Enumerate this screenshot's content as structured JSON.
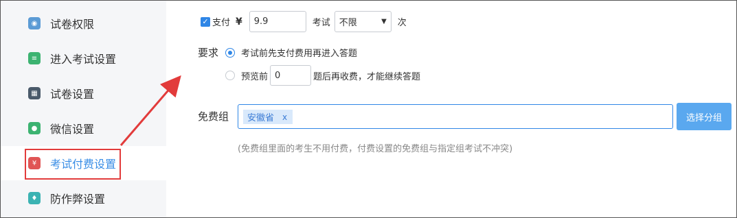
{
  "sidebar": {
    "items": [
      {
        "label": "试卷权限",
        "icon": "permission-icon",
        "color": "#5b9bd5"
      },
      {
        "label": "进入考试设置",
        "icon": "enter-exam-icon",
        "color": "#3cb371"
      },
      {
        "label": "试卷设置",
        "icon": "paper-settings-icon",
        "color": "#4a5a6a"
      },
      {
        "label": "微信设置",
        "icon": "wechat-icon",
        "color": "#3cb371"
      },
      {
        "label": "考试付费设置",
        "icon": "payment-icon",
        "color": "#e05555"
      },
      {
        "label": "防作弊设置",
        "icon": "shield-icon",
        "color": "#3bb3b3"
      }
    ]
  },
  "payment": {
    "pay_label": "支付",
    "currency": "¥",
    "amount": "9.9",
    "exam_label": "考试",
    "times_value": "不限",
    "times_unit": "次"
  },
  "requirement": {
    "label": "要求",
    "option1": "考试前先支付费用再进入答题",
    "option2_prefix": "预览前",
    "option2_value": "0",
    "option2_suffix": "题后再收费，才能继续答题"
  },
  "free_group": {
    "label": "免费组",
    "tag": "安徽省",
    "tag_remove": "x",
    "choose_button": "选择分组",
    "hint": "(免费组里面的考生不用付费，付费设置的免费组与指定组考试不冲突)"
  },
  "colors": {
    "accent": "#2f86e6",
    "annotation": "#e23b3b"
  }
}
